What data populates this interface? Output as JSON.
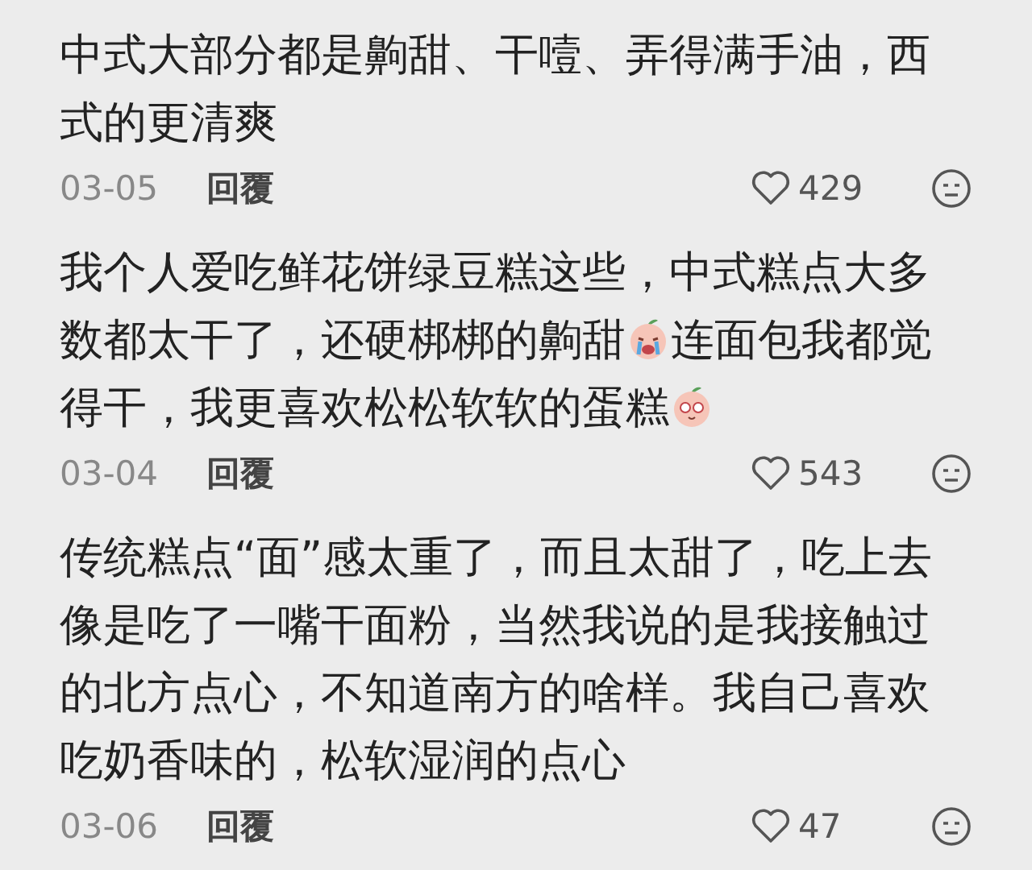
{
  "comments": [
    {
      "parts": [
        {
          "kind": "text",
          "text": "中式大部分都是齁甜、干噎、弄得满手油，西式的更清爽"
        }
      ],
      "date": "03-05",
      "reply": "回覆",
      "likes": "429"
    },
    {
      "parts": [
        {
          "kind": "text",
          "text": "我个人爱吃鲜花饼绿豆糕这些，中式糕点大多数都太干了，还硬梆梆的齁甜"
        },
        {
          "kind": "crying"
        },
        {
          "kind": "text",
          "text": "连面包我都觉得干，我更喜欢松松软软的蛋糕"
        },
        {
          "kind": "starry"
        }
      ],
      "date": "03-04",
      "reply": "回覆",
      "likes": "543"
    },
    {
      "parts": [
        {
          "kind": "text",
          "text": "传统糕点“面”感太重了，而且太甜了，吃上去像是吃了一嘴干面粉，当然我说的是我接触过的北方点心，不知道南方的啥样。我自己喜欢吃奶香味的，松软湿润的点心"
        }
      ],
      "date": "03-06",
      "reply": "回覆",
      "likes": "47"
    }
  ]
}
